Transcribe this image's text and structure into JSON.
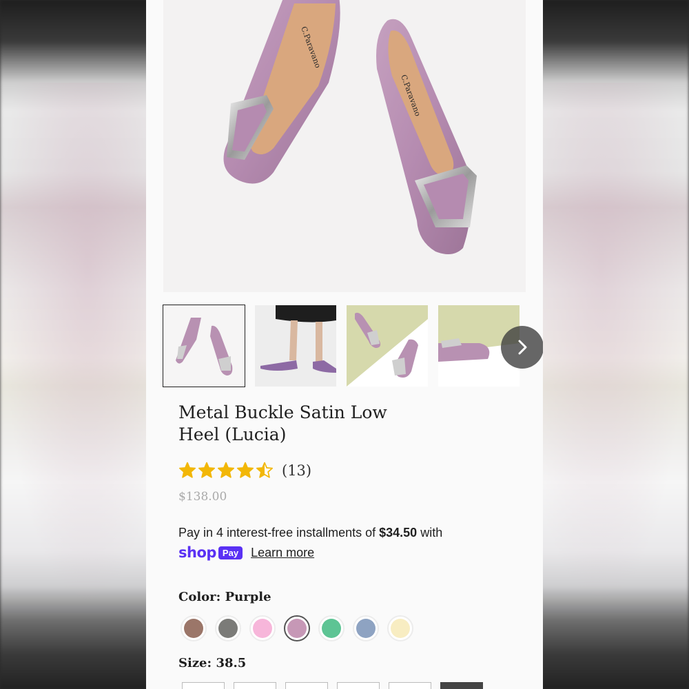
{
  "product": {
    "title": "Metal Buckle Satin Low Heel (Lucia)",
    "rating": 4.5,
    "review_count": "(13)",
    "price": "$138.00"
  },
  "installments": {
    "prefix": "Pay in 4 interest-free installments of ",
    "amount": "$34.50",
    "suffix": " with",
    "shop_word": "shop",
    "pay_badge": "Pay",
    "learn_more": "Learn more"
  },
  "color": {
    "label": "Color:",
    "value": "Purple",
    "swatches": [
      {
        "name": "brown",
        "hex": "#9b7669"
      },
      {
        "name": "gray",
        "hex": "#7b7b78"
      },
      {
        "name": "pink",
        "hex": "#f7b6da"
      },
      {
        "name": "purple",
        "hex": "#c698b6",
        "selected": true
      },
      {
        "name": "green",
        "hex": "#5dc494"
      },
      {
        "name": "blue",
        "hex": "#8ea3c2"
      },
      {
        "name": "cream",
        "hex": "#f8edc2"
      }
    ]
  },
  "size": {
    "label": "Size:",
    "value": "38.5"
  },
  "gallery": {
    "thumbnails": [
      "pair-top-view",
      "model-wearing",
      "pair-diagonal",
      "side-view"
    ],
    "selected_index": 0
  },
  "brand_insole": "C.Paravano",
  "colors": {
    "accent_shop": "#5a31f4",
    "star": "#f2b707"
  }
}
